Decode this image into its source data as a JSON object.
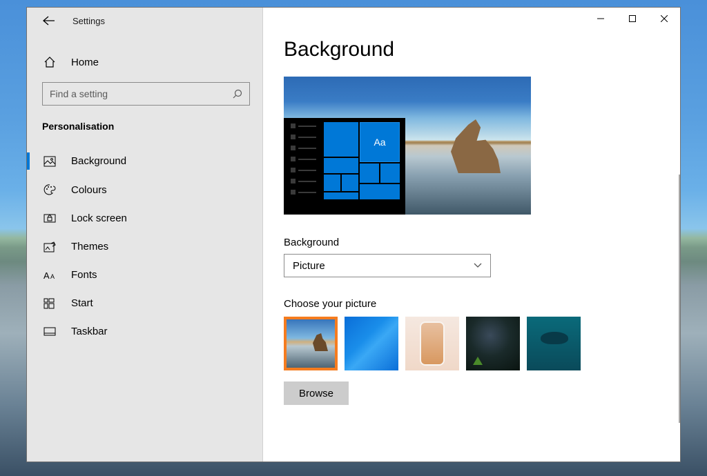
{
  "window_title": "Settings",
  "sidebar": {
    "home_label": "Home",
    "search_placeholder": "Find a setting",
    "section_title": "Personalisation",
    "items": [
      {
        "label": "Background",
        "icon": "picture-icon",
        "active": true
      },
      {
        "label": "Colours",
        "icon": "palette-icon",
        "active": false
      },
      {
        "label": "Lock screen",
        "icon": "lockscreen-icon",
        "active": false
      },
      {
        "label": "Themes",
        "icon": "themes-icon",
        "active": false
      },
      {
        "label": "Fonts",
        "icon": "fonts-icon",
        "active": false
      },
      {
        "label": "Start",
        "icon": "start-icon",
        "active": false
      },
      {
        "label": "Taskbar",
        "icon": "taskbar-icon",
        "active": false
      }
    ]
  },
  "main": {
    "page_title": "Background",
    "preview_sample_text": "Aa",
    "background_field_label": "Background",
    "background_dropdown_value": "Picture",
    "choose_picture_label": "Choose your picture",
    "browse_label": "Browse"
  }
}
